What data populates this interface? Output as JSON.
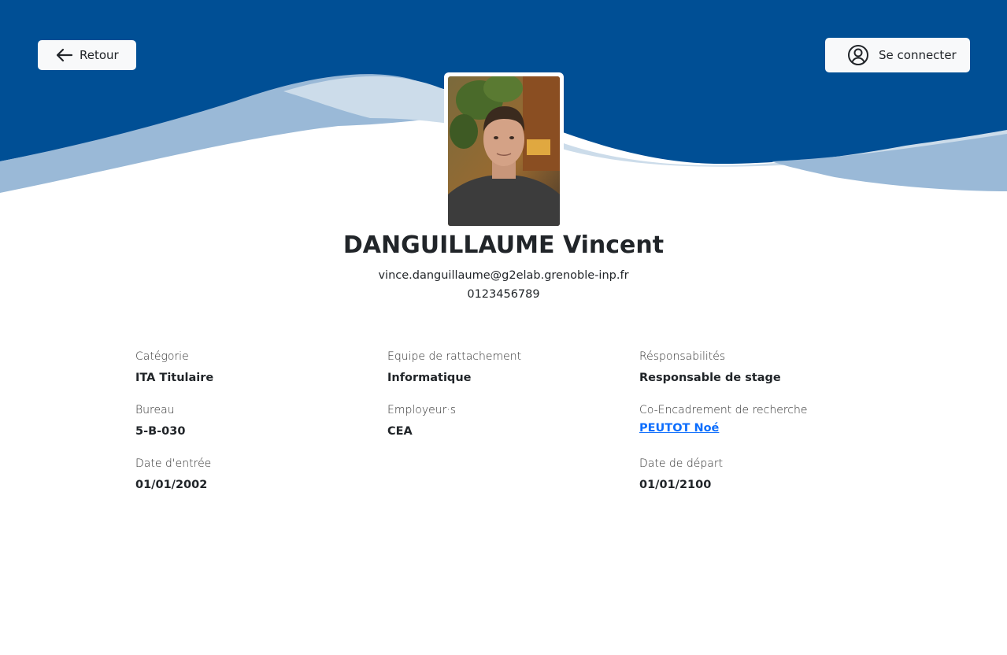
{
  "header": {
    "back_label": "Retour",
    "login_label": "Se connecter",
    "colors": {
      "primary": "#004f95",
      "wave_light": "#9ab9d7",
      "wave_lighter": "#ccdcea"
    }
  },
  "profile": {
    "name": "DANGUILLAUME Vincent",
    "email": "vince.danguillaume@g2elab.grenoble-inp.fr",
    "phone": "0123456789",
    "photo_alt": "portrait photo"
  },
  "details": {
    "categorie": {
      "label": "Catégorie",
      "value": "ITA Titulaire"
    },
    "equipe": {
      "label": "Equipe de rattachement",
      "value": "Informatique"
    },
    "responsabilites": {
      "label": "Résponsabilités",
      "value": "Responsable de stage"
    },
    "bureau": {
      "label": "Bureau",
      "value": "5-B-030"
    },
    "employeur": {
      "label": "Employeur·s",
      "value": "CEA"
    },
    "co_encadrement": {
      "label": "Co-Encadrement de recherche",
      "value": "PEUTOT Noé"
    },
    "date_entree": {
      "label": "Date d'entrée",
      "value": "01/01/2002"
    },
    "date_depart": {
      "label": "Date de départ",
      "value": "01/01/2100"
    }
  }
}
